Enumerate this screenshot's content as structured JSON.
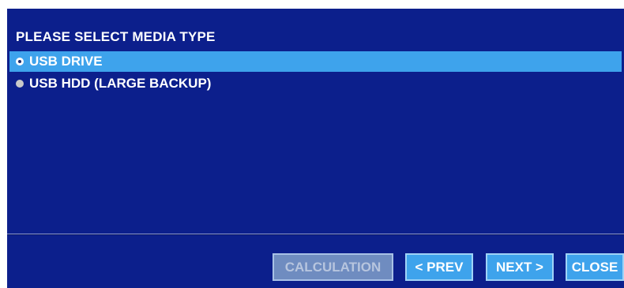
{
  "dialog": {
    "heading": "PLEASE SELECT MEDIA TYPE",
    "options": [
      {
        "label": "USB DRIVE",
        "selected": true
      },
      {
        "label": "USB HDD (LARGE BACKUP)",
        "selected": false
      }
    ]
  },
  "buttons": {
    "calculation": "CALCULATION",
    "prev": "< PREV",
    "next": "NEXT >",
    "close": "CLOSE"
  },
  "colors": {
    "panel_background": "#0c1f8c",
    "selection_highlight": "#3ea3ec",
    "button_background": "#3ea3ec",
    "disabled_button_background": "#6f8cc0"
  }
}
